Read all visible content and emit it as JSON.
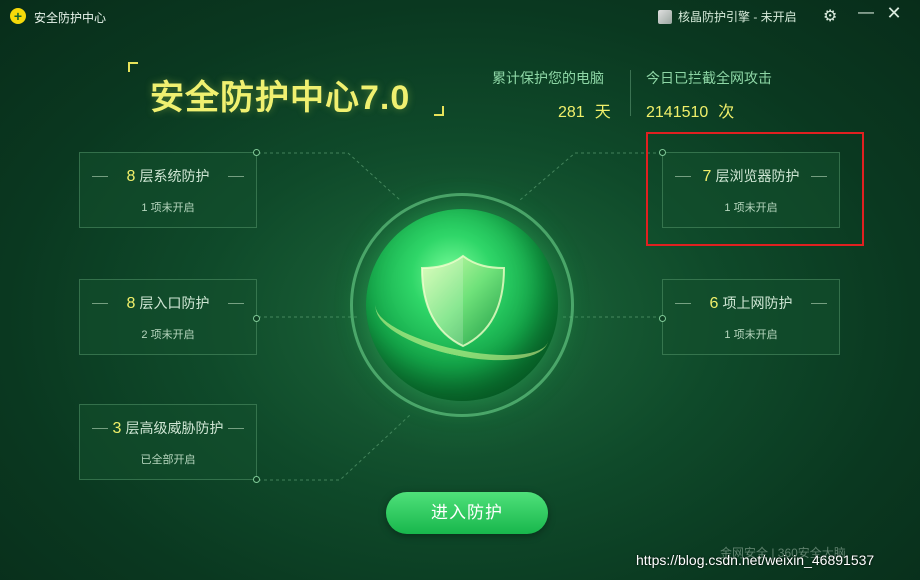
{
  "window": {
    "title": "安全防护中心",
    "engine_status": "核晶防护引擎 - 未开启"
  },
  "brand": {
    "title": "安全防护中心7.0"
  },
  "stats": [
    {
      "label": "累计保护您的电脑",
      "value": "281",
      "unit": "天"
    },
    {
      "label": "今日已拦截全网攻击",
      "value": "2141510",
      "unit": "次"
    }
  ],
  "left_boxes": [
    {
      "num": "8",
      "title": "层系统防护",
      "status": "1 项未开启"
    },
    {
      "num": "8",
      "title": "层入口防护",
      "status": "2 项未开启"
    },
    {
      "num": "3",
      "title": "层高级威胁防护",
      "status": "已全部开启"
    }
  ],
  "right_boxes": [
    {
      "num": "7",
      "title": "层浏览器防护",
      "status": "1 项未开启"
    },
    {
      "num": "6",
      "title": "项上网防护",
      "status": "1 项未开启"
    }
  ],
  "enter_button": "进入防护",
  "footer_text": "金网安全 | 360安全大脑",
  "watermark": "https://blog.csdn.net/weixin_46891537",
  "icons": {
    "app_logo": "plus-logo-icon",
    "engine": "cube-icon",
    "settings": "gear-icon",
    "minimize": "minimize-icon",
    "close": "close-icon",
    "shield": "shield-icon"
  },
  "colors": {
    "accent_yellow": "#f0ef6a",
    "highlight_red": "#e02020",
    "button_green": "#18b74c"
  }
}
